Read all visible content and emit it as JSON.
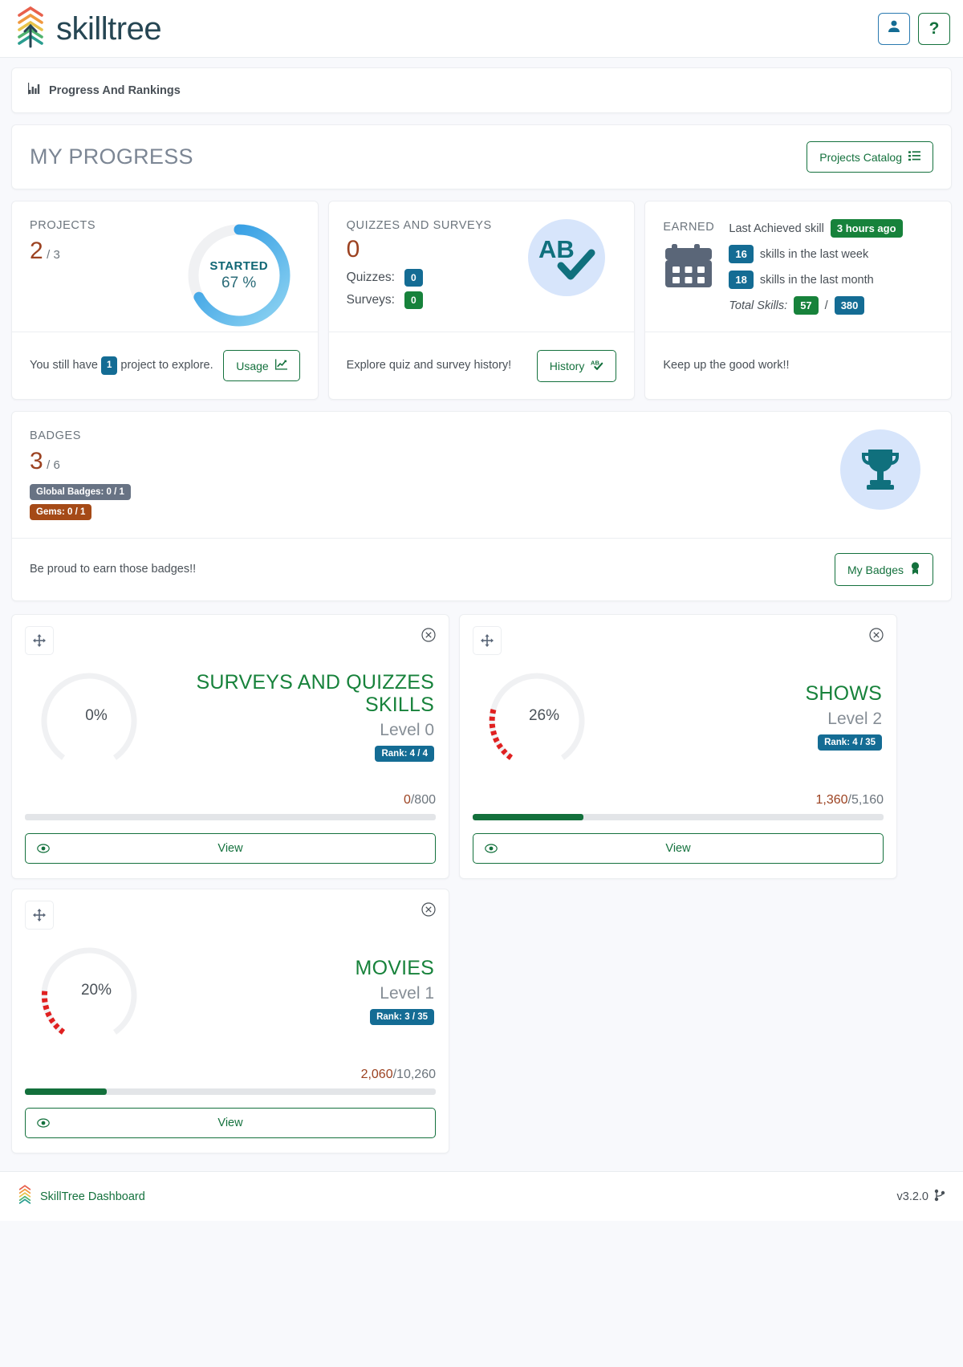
{
  "header": {
    "brand": "skilltree",
    "logo_icon": "skilltree-chevron-logo",
    "user_button_icon": "user-icon",
    "help_button_label": "?"
  },
  "breadcrumb": {
    "icon": "chart-bar-icon",
    "text": "Progress And Rankings"
  },
  "progress_header": {
    "title": "MY PROGRESS",
    "catalog_button": "Projects Catalog",
    "catalog_icon": "list-check-icon"
  },
  "projects_card": {
    "label": "PROJECTS",
    "value": "2",
    "total": "/ 3",
    "donut": {
      "status": "STARTED",
      "percent_text": "67 %",
      "percent": 67,
      "color_start": "#8fd4f2",
      "color_end": "#1e90e0"
    },
    "footer_text_before": "You still have",
    "footer_badge": "1",
    "footer_text_after": "project to explore.",
    "button_label": "Usage",
    "button_icon": "chart-line-icon"
  },
  "quizzes_card": {
    "label": "QUIZZES AND SURVEYS",
    "value": "0",
    "rows": [
      {
        "label": "Quizzes:",
        "count": "0",
        "color": "#146c94"
      },
      {
        "label": "Surveys:",
        "count": "0",
        "color": "#17823b"
      }
    ],
    "icon_name": "ab-check-icon",
    "icon_text": "AB",
    "footer_text": "Explore quiz and survey history!",
    "button_label": "History",
    "button_icon": "ab-check-small-icon"
  },
  "earned_card": {
    "label": "EARNED",
    "icon_name": "calendar-icon",
    "last_achieved_label": "Last Achieved skill",
    "last_achieved_time": "3 hours ago",
    "week_count": "16",
    "week_text": "skills in the last week",
    "month_count": "18",
    "month_text": "skills in the last month",
    "total_label": "Total Skills:",
    "total_earned": "57",
    "total_separator": "/",
    "total_available": "380",
    "footer_text": "Keep up the good work!!"
  },
  "badges_card": {
    "label": "BADGES",
    "value": "3",
    "total": "/ 6",
    "pills": [
      {
        "text": "Global Badges: 0 / 1",
        "color": "#687384"
      },
      {
        "text": "Gems: 0 / 1",
        "color": "#a54a17"
      }
    ],
    "icon_name": "trophy-icon",
    "footer_text": "Be proud to earn those badges!!",
    "button_label": "My Badges",
    "button_icon": "badge-award-icon"
  },
  "tiles": [
    {
      "name": "SURVEYS AND QUIZZES SKILLS",
      "percent_text": "0%",
      "percent": 0,
      "level": "Level 0",
      "rank": "Rank: 4 / 4",
      "points_earned": "0",
      "points_separator": "/800",
      "bar_percent": 0,
      "view_label": "View",
      "move_icon": "move-arrows-icon",
      "close_icon": "close-circle-icon",
      "eye_icon": "eye-icon"
    },
    {
      "name": "SHOWS",
      "percent_text": "26%",
      "percent": 26,
      "level": "Level 2",
      "rank": "Rank: 4 / 35",
      "points_earned": "1,360",
      "points_separator": "/5,160",
      "bar_percent": 26,
      "view_label": "View",
      "move_icon": "move-arrows-icon",
      "close_icon": "close-circle-icon",
      "eye_icon": "eye-icon"
    },
    {
      "name": "MOVIES",
      "percent_text": "20%",
      "percent": 20,
      "level": "Level 1",
      "rank": "Rank: 3 / 35",
      "points_earned": "2,060",
      "points_separator": "/10,260",
      "bar_percent": 20,
      "view_label": "View",
      "move_icon": "move-arrows-icon",
      "close_icon": "close-circle-icon",
      "eye_icon": "eye-icon"
    }
  ],
  "footer": {
    "logo_icon": "skilltree-chevron-logo-small",
    "link_label": "SkillTree Dashboard",
    "version": "v3.2.0",
    "version_icon": "code-branch-icon"
  }
}
